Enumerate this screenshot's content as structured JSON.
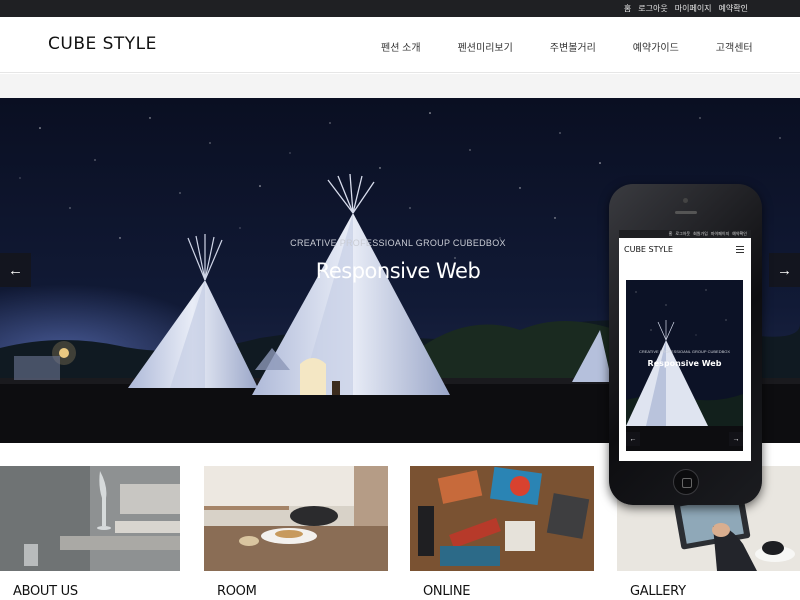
{
  "topbar": {
    "links": [
      "홈",
      "로그아웃",
      "마이페이지",
      "예약확인"
    ]
  },
  "header": {
    "logo": "CUBE STYLE",
    "nav": [
      "펜션 소개",
      "펜션미리보기",
      "주변볼거리",
      "예약가이드",
      "고객센터"
    ]
  },
  "hero": {
    "subtitle": "CREATIVE PROFESSIOANL GROUP  CUBEDBOX",
    "title": "Responsive Web",
    "prev_icon": "arrow-left-icon",
    "next_icon": "arrow-right-icon"
  },
  "phone": {
    "topbar_links": [
      "홈",
      "로그아웃",
      "회원가입",
      "마이페이지",
      "예약확인"
    ],
    "logo": "CUBE STYLE",
    "menu_icon": "hamburger-menu-icon",
    "hero_subtitle": "CREATIVE PROFESSIOANL GROUP  CUBEDBOX",
    "hero_title": "Responsive Web"
  },
  "cards": [
    {
      "title": "ABOUT US"
    },
    {
      "title": "ROOM"
    },
    {
      "title": "ONLINE"
    },
    {
      "title": "GALLERY"
    }
  ],
  "colors": {
    "topbar_bg": "#1f2023",
    "hero_sky": "#0b1020",
    "text_dark": "#111111"
  }
}
